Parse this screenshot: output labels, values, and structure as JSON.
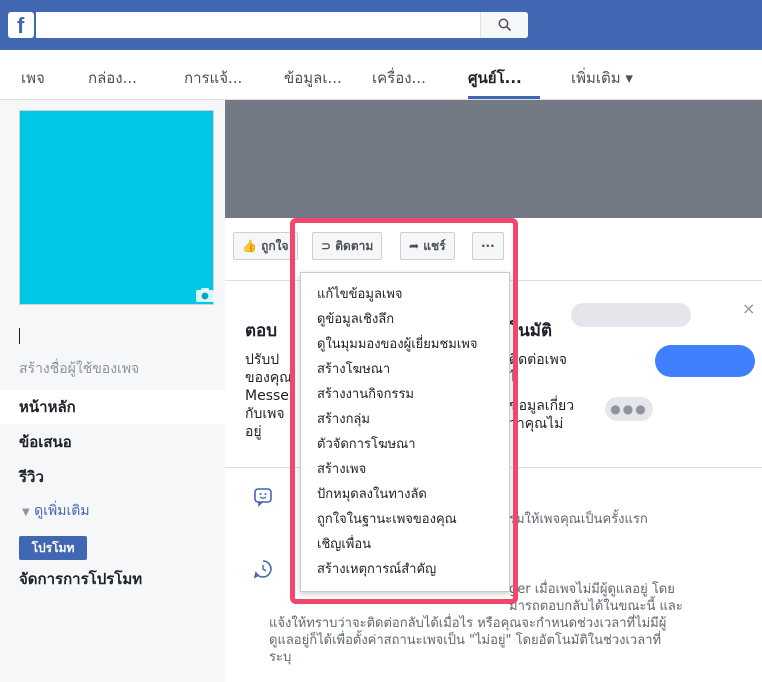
{
  "topbar": {
    "logo": "f",
    "search_placeholder": ""
  },
  "tabs": [
    {
      "label": "เพจ"
    },
    {
      "label": "กล่อง..."
    },
    {
      "label": "การแจ้..."
    },
    {
      "label": "ข้อมูลเ..."
    },
    {
      "label": "เครื่อง..."
    },
    {
      "label": "ศูนย์โ..."
    },
    {
      "label": "เพิ่มเติม ▾"
    }
  ],
  "sidebar": {
    "create_username": "สร้างชื่อผู้ใช้ของเพจ",
    "items": [
      {
        "label": "หน้าหลัก"
      },
      {
        "label": "ข้อเสนอ"
      },
      {
        "label": "รีวิว"
      }
    ],
    "see_more": "ดูเพิ่มเติม",
    "promote_button": "โปรโมท",
    "manage_promotions": "จัดการการโปรโมท"
  },
  "actions": {
    "like": "ถูกใจ",
    "follow": "ติดตาม",
    "share": "แชร์",
    "more": "···"
  },
  "card": {
    "title_left": "ตอบ",
    "title_right": "โนมัติ",
    "left_lines": [
      "ปรับป",
      "ของคุณ",
      "Messe",
      "กับเพจ",
      "อยู่"
    ],
    "right_lines": [
      "ติดต่อเพจ",
      "ไ",
      "ข้อมูลเกี่ยว",
      "ว่าคุณไม่"
    ],
    "close": "×",
    "dots": "●●●",
    "row1_text": "รมให้เพจคุณเป็นครั้งแรก",
    "row2_lines": [
      "ger เมื่อเพจไม่มีผู้ดูแลอยู่ โดย",
      "มารถตอบกลับได้ในขณะนี้ และ",
      "แจ้งให้ทราบว่าจะติดต่อกลับได้เมื่อไร หรือคุณจะกำหนดช่วงเวลาที่ไม่มีผู้",
      "ดูแลอยู่ก็ได้เพื่อตั้งค่าสถานะเพจเป็น \"ไม่อยู่\" โดยอัตโนมัติในช่วงเวลาที่",
      "ระบุ"
    ]
  },
  "dropdown": {
    "items": [
      {
        "label": "แก้ไขข้อมูลเพจ"
      },
      {
        "label": "ดูข้อมูลเชิงลึก"
      },
      {
        "label": "ดูในมุมมองของผู้เยี่ยมชมเพจ"
      },
      {
        "label": "สร้างโฆษณา"
      },
      {
        "label": "สร้างงานกิจกรรม"
      },
      {
        "label": "สร้างกลุ่ม"
      },
      {
        "label": "ตัวจัดการโฆษณา"
      },
      {
        "label": "สร้างเพจ"
      },
      {
        "label": "ปักหมุดลงในทางลัด"
      },
      {
        "label": "ถูกใจในฐานะเพจของคุณ"
      },
      {
        "label": "เชิญเพื่อน"
      },
      {
        "label": "สร้างเหตุการณ์สำคัญ"
      }
    ]
  },
  "colors": {
    "brand": "#4267b2",
    "highlight": "#f2466c",
    "profile": "#00c8e4"
  }
}
